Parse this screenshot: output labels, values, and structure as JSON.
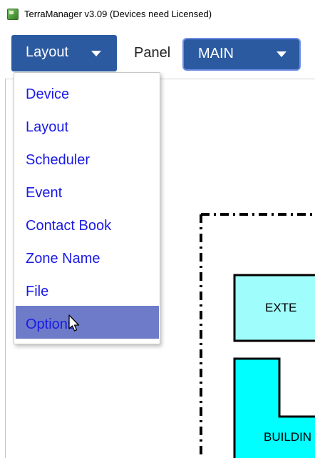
{
  "window": {
    "title": "TerraManager v3.09 (Devices need Licensed)",
    "icon": "app-icon"
  },
  "toolbar": {
    "layout_button": "Layout",
    "panel_label": "Panel",
    "panel_value": "MAIN"
  },
  "menu": {
    "items": [
      {
        "label": "Device"
      },
      {
        "label": "Layout"
      },
      {
        "label": "Scheduler"
      },
      {
        "label": "Event"
      },
      {
        "label": "Contact Book"
      },
      {
        "label": "Zone Name"
      },
      {
        "label": "File"
      },
      {
        "label": "Options"
      }
    ],
    "selected": "Options"
  },
  "plan": {
    "labels": {
      "zone_1": "EXTE",
      "zone_2": "BUILDIN"
    },
    "colors": {
      "zone_1_fill": "#9ffdfb",
      "zone_2_fill": "#00ffff"
    }
  },
  "colors": {
    "accent": "#2b5aa1",
    "menu_text": "#1a1ae6",
    "menu_selected_bg": "#6d7bc9"
  }
}
